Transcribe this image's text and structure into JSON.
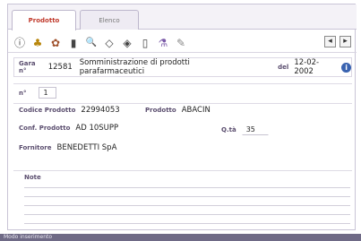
{
  "tabs": [
    {
      "label": "Prodotto"
    },
    {
      "label": "Elenco"
    }
  ],
  "toolbar": {
    "icons": [
      "info-icon",
      "tag-icon",
      "package-icon",
      "trash-icon",
      "search-icon",
      "print-icon",
      "save-icon",
      "bottle-icon",
      "flask-icon",
      "edit-icon"
    ],
    "glyphs": [
      "ⓘ",
      "♣",
      "✿",
      "▮",
      "🔍",
      "◇",
      "◈",
      "▯",
      "⚗",
      "✎"
    ],
    "prev_label": "◂",
    "next_label": "▸"
  },
  "gara": {
    "label": "Gara n°",
    "number": "12581",
    "description": "Somministrazione di prodotti parafarmaceutici",
    "date_label": "del",
    "date": "12-02-2002"
  },
  "form": {
    "n_label": "n°",
    "n_value": "1",
    "codice_label": "Codice Prodotto",
    "codice_value": "22994053",
    "prodotto_label": "Prodotto",
    "prodotto_value": "ABACIN",
    "conf_label": "Conf. Prodotto",
    "conf_value": "AD 10SUPP",
    "qta_label": "Q.tà",
    "qta_value": "35",
    "fornitore_label": "Fornitore",
    "fornitore_value": "BENEDETTI SpA",
    "note_label": "Note"
  },
  "footer": {
    "text": "Modo inserimento"
  },
  "colors": {
    "active_tab": "#c0392b",
    "label": "#5a4d6e",
    "footer_bg": "#6f6a86",
    "info_icon": "#3a63b0"
  }
}
